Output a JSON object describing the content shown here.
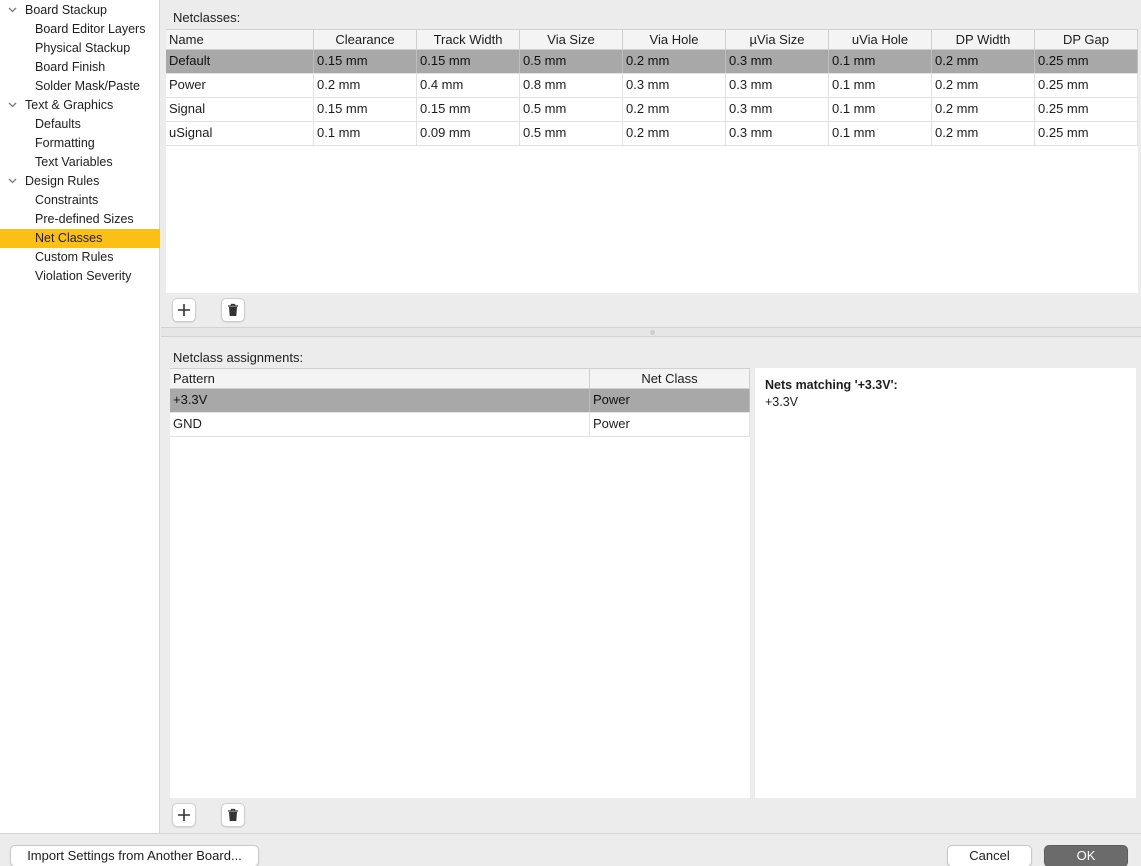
{
  "sidebar": {
    "items": [
      {
        "label": "Board Stackup",
        "level": 0,
        "expanded": true
      },
      {
        "label": "Board Editor Layers",
        "level": 1
      },
      {
        "label": "Physical Stackup",
        "level": 1
      },
      {
        "label": "Board Finish",
        "level": 1
      },
      {
        "label": "Solder Mask/Paste",
        "level": 1
      },
      {
        "label": "Text & Graphics",
        "level": 0,
        "expanded": true
      },
      {
        "label": "Defaults",
        "level": 1
      },
      {
        "label": "Formatting",
        "level": 1
      },
      {
        "label": "Text Variables",
        "level": 1
      },
      {
        "label": "Design Rules",
        "level": 0,
        "expanded": true
      },
      {
        "label": "Constraints",
        "level": 1
      },
      {
        "label": "Pre-defined Sizes",
        "level": 1
      },
      {
        "label": "Net Classes",
        "level": 1,
        "selected": true
      },
      {
        "label": "Custom Rules",
        "level": 1
      },
      {
        "label": "Violation Severity",
        "level": 1
      }
    ],
    "selected_color": "#fcbf16"
  },
  "netclasses": {
    "label": "Netclasses:",
    "columns": [
      "Name",
      "Clearance",
      "Track Width",
      "Via Size",
      "Via Hole",
      "µVia Size",
      "uVia Hole",
      "DP Width",
      "DP Gap"
    ],
    "rows": [
      [
        "Default",
        "0.15 mm",
        "0.15 mm",
        "0.5 mm",
        "0.2 mm",
        "0.3 mm",
        "0.1 mm",
        "0.2 mm",
        "0.25 mm"
      ],
      [
        "Power",
        "0.2 mm",
        "0.4 mm",
        "0.8 mm",
        "0.3 mm",
        "0.3 mm",
        "0.1 mm",
        "0.2 mm",
        "0.25 mm"
      ],
      [
        "Signal",
        "0.15 mm",
        "0.15 mm",
        "0.5 mm",
        "0.2 mm",
        "0.3 mm",
        "0.1 mm",
        "0.2 mm",
        "0.25 mm"
      ],
      [
        "uSignal",
        "0.1 mm",
        "0.09 mm",
        "0.5 mm",
        "0.2 mm",
        "0.3 mm",
        "0.1 mm",
        "0.2 mm",
        "0.25 mm"
      ]
    ],
    "selected_row": 0
  },
  "assignments": {
    "label": "Netclass assignments:",
    "columns": [
      "Pattern",
      "Net Class"
    ],
    "rows": [
      [
        "+3.3V",
        "Power"
      ],
      [
        "GND",
        "Power"
      ]
    ],
    "selected_row": 0
  },
  "nets_panel": {
    "title": "Nets matching '+3.3V':",
    "nets": [
      "+3.3V"
    ]
  },
  "icons": {
    "add": "plus-icon",
    "delete": "trash-icon",
    "expand": "chevron-down-icon"
  },
  "buttons": {
    "import": "Import Settings from Another Board...",
    "cancel": "Cancel",
    "ok": "OK"
  }
}
